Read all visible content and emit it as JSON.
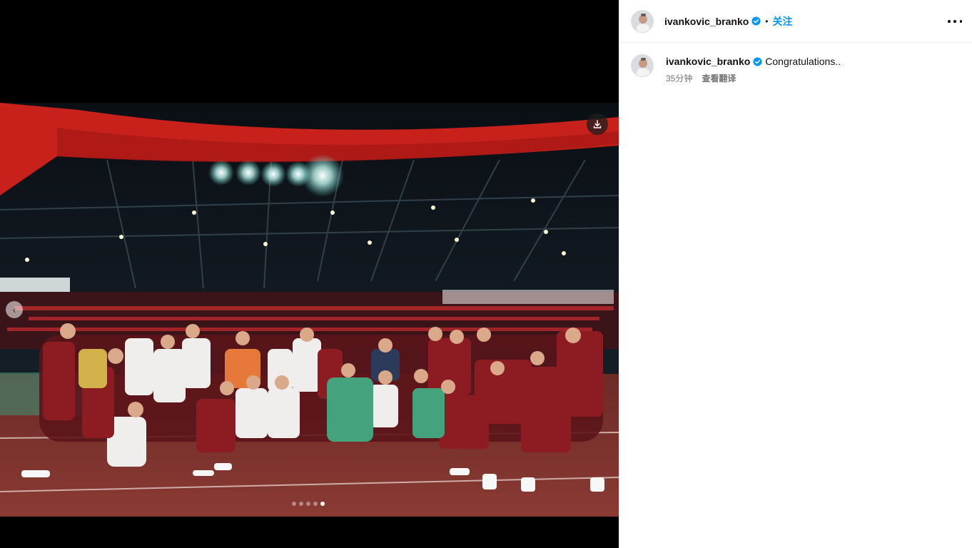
{
  "post": {
    "author": "ivankovic_branko",
    "follow_label": "关注",
    "separator": "•",
    "more_icon": "more-horizontal-icon"
  },
  "caption": {
    "author": "ivankovic_branko",
    "text": "Congratulations..",
    "time": "35分钟",
    "translate_label": "查看翻译"
  },
  "carousel": {
    "slide_count": 5,
    "active_index": 4,
    "prev_icon": "chevron-left-icon",
    "download_icon": "download-icon"
  },
  "colors": {
    "follow_accent": "#0095f6",
    "verified_badge": "#0095f6",
    "stadium_roof": "#c8211c",
    "jersey_red": "#8c1c22",
    "track": "#7a2f2a"
  }
}
